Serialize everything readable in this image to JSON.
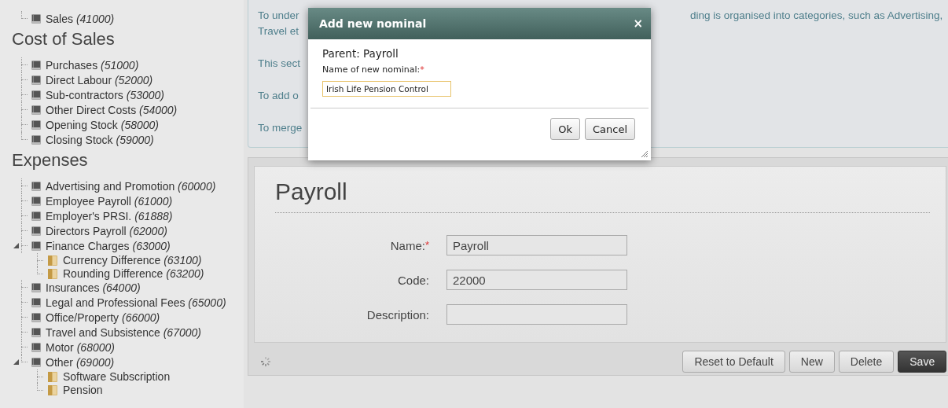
{
  "sidebar": {
    "sections": [
      {
        "items": [
          {
            "label": "Sales *(41000)*",
            "kind": "account",
            "expanded": false
          }
        ]
      },
      {
        "heading": "Cost of Sales",
        "items": [
          {
            "label": "Purchases *(51000)*",
            "kind": "account",
            "expanded": false
          },
          {
            "label": "Direct Labour *(52000)*",
            "kind": "account",
            "expanded": false
          },
          {
            "label": "Sub-contractors *(53000)*",
            "kind": "account",
            "expanded": false
          },
          {
            "label": "Other Direct Costs *(54000)*",
            "kind": "account",
            "expanded": false
          },
          {
            "label": "Opening Stock *(58000)*",
            "kind": "account",
            "expanded": false
          },
          {
            "label": "Closing Stock *(59000)*",
            "kind": "account",
            "expanded": false
          }
        ]
      },
      {
        "heading": "Expenses",
        "items": [
          {
            "label": "Advertising and Promotion *(60000)*",
            "kind": "account",
            "expanded": false
          },
          {
            "label": "Employee Payroll *(61000)*",
            "kind": "account",
            "expanded": false
          },
          {
            "label": "Employer's PRSI. *(61888)*",
            "kind": "account",
            "expanded": false
          },
          {
            "label": "Directors Payroll *(62000)*",
            "kind": "account",
            "expanded": false
          },
          {
            "label": "Finance Charges *(63000)*",
            "kind": "account",
            "expanded": true,
            "children": [
              {
                "label": "Currency Difference *(63100)*",
                "kind": "folder",
                "expanded": false
              },
              {
                "label": "Rounding Difference *(63200)*",
                "kind": "folder",
                "expanded": false
              }
            ]
          },
          {
            "label": "Insurances *(64000)*",
            "kind": "account",
            "expanded": false
          },
          {
            "label": "Legal and Professional Fees *(65000)*",
            "kind": "account",
            "expanded": false
          },
          {
            "label": "Office/Property *(66000)*",
            "kind": "account",
            "expanded": false
          },
          {
            "label": "Travel and Subsistence *(67000)*",
            "kind": "account",
            "expanded": false
          },
          {
            "label": "Motor *(68000)*",
            "kind": "account",
            "expanded": false
          },
          {
            "label": "Other *(69000)*",
            "kind": "account",
            "expanded": true,
            "children": [
              {
                "label": "Software Subscription",
                "kind": "folder",
                "expanded": false
              },
              {
                "label": "Pension",
                "kind": "folder",
                "expanded": false
              }
            ]
          }
        ]
      }
    ]
  },
  "info_panel": {
    "paragraphs": [
      [
        {
          "left": "To under",
          "right": "ding is organised into categories, such as Advertising,"
        },
        {
          "left": "Travel et"
        }
      ],
      [
        {
          "left": "This sect"
        }
      ],
      [
        {
          "left": "To add o"
        }
      ],
      [
        {
          "left": "To merge"
        }
      ]
    ]
  },
  "dialog": {
    "title": "Add new nominal",
    "close": "×",
    "parent": "Parent: Payroll",
    "field_label": "Name of new nominal:",
    "required_mark": "*",
    "value": "Irish Life Pension Control",
    "buttons": [
      "Ok",
      "Cancel"
    ]
  },
  "form": {
    "title": "Payroll",
    "fields": [
      {
        "label": "Name:",
        "required_mark": "*",
        "value": "Payroll"
      },
      {
        "label": "Code:",
        "value": "22000"
      },
      {
        "label": "Description:"
      }
    ],
    "buttons": [
      {
        "label": "Reset to Default",
        "kind": "normal"
      },
      {
        "label": "New",
        "kind": "normal"
      },
      {
        "label": "Delete",
        "kind": "normal"
      },
      {
        "label": "Save",
        "kind": "primary"
      }
    ]
  }
}
